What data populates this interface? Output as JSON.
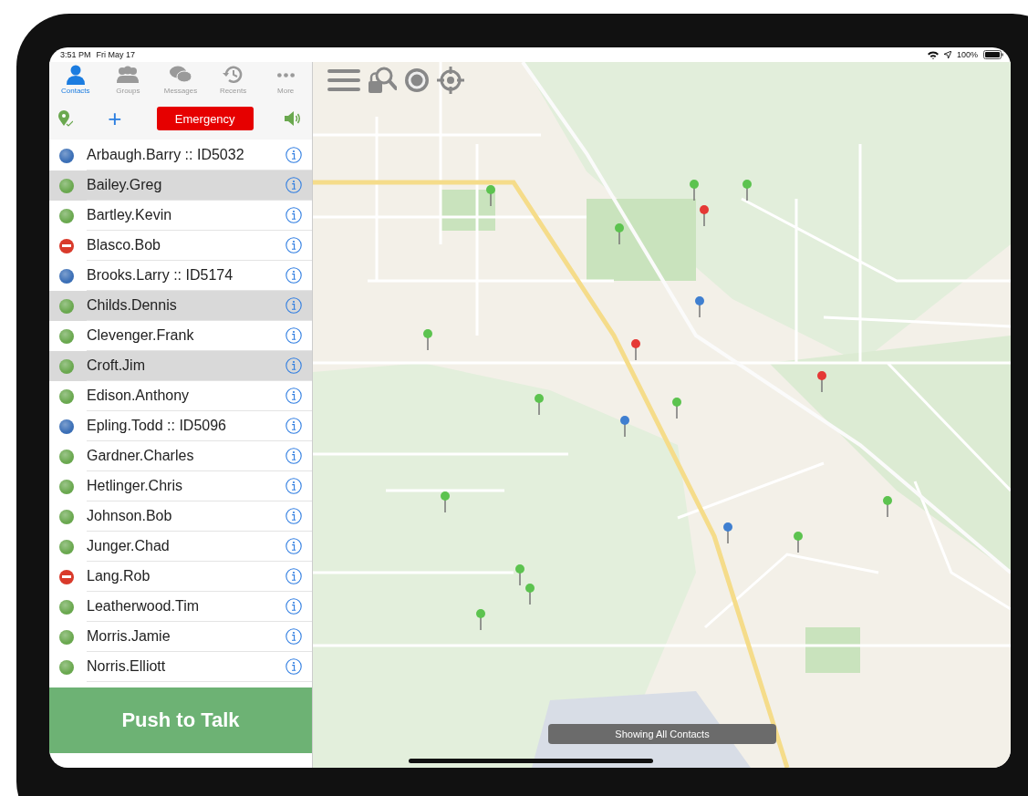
{
  "status_bar": {
    "time": "3:51 PM",
    "date": "Fri May 17",
    "battery": "100%"
  },
  "tabs": [
    {
      "label": "Contacts",
      "kind": "person",
      "selected": true
    },
    {
      "label": "Groups",
      "kind": "group",
      "selected": false
    },
    {
      "label": "Messages",
      "kind": "bubbles",
      "selected": false
    },
    {
      "label": "Recents",
      "kind": "clock",
      "selected": false
    },
    {
      "label": "More",
      "kind": "dots",
      "selected": false
    }
  ],
  "toolbar": {
    "add": "+",
    "emergency": "Emergency"
  },
  "contacts": [
    {
      "name": "Arbaugh.Barry :: ID5032",
      "kind": "dot",
      "color": "#3b6fb6",
      "selected": false
    },
    {
      "name": "Bailey.Greg",
      "kind": "dot",
      "color": "#6aa84f",
      "selected": true
    },
    {
      "name": "Bartley.Kevin",
      "kind": "dot",
      "color": "#6aa84f",
      "selected": false
    },
    {
      "name": "Blasco.Bob",
      "kind": "no-entry",
      "color": "#d93a2b",
      "selected": false
    },
    {
      "name": "Brooks.Larry :: ID5174",
      "kind": "dot",
      "color": "#3b6fb6",
      "selected": false
    },
    {
      "name": "Childs.Dennis",
      "kind": "dot",
      "color": "#6aa84f",
      "selected": true
    },
    {
      "name": "Clevenger.Frank",
      "kind": "dot",
      "color": "#6aa84f",
      "selected": false
    },
    {
      "name": "Croft.Jim",
      "kind": "dot",
      "color": "#6aa84f",
      "selected": true
    },
    {
      "name": "Edison.Anthony",
      "kind": "dot",
      "color": "#6aa84f",
      "selected": false
    },
    {
      "name": "Epling.Todd :: ID5096",
      "kind": "dot",
      "color": "#3b6fb6",
      "selected": false
    },
    {
      "name": "Gardner.Charles",
      "kind": "dot",
      "color": "#6aa84f",
      "selected": false
    },
    {
      "name": "Hetlinger.Chris",
      "kind": "dot",
      "color": "#6aa84f",
      "selected": false
    },
    {
      "name": "Johnson.Bob",
      "kind": "dot",
      "color": "#6aa84f",
      "selected": false
    },
    {
      "name": "Junger.Chad",
      "kind": "dot",
      "color": "#6aa84f",
      "selected": false
    },
    {
      "name": "Lang.Rob",
      "kind": "no-entry",
      "color": "#d93a2b",
      "selected": false
    },
    {
      "name": "Leatherwood.Tim",
      "kind": "dot",
      "color": "#6aa84f",
      "selected": false
    },
    {
      "name": "Morris.Jamie",
      "kind": "dot",
      "color": "#6aa84f",
      "selected": false
    },
    {
      "name": "Norris.Elliott",
      "kind": "dot",
      "color": "#6aa84f",
      "selected": false
    }
  ],
  "push_to_talk": "Push to Talk",
  "map": {
    "toast": "Showing All Contacts"
  }
}
